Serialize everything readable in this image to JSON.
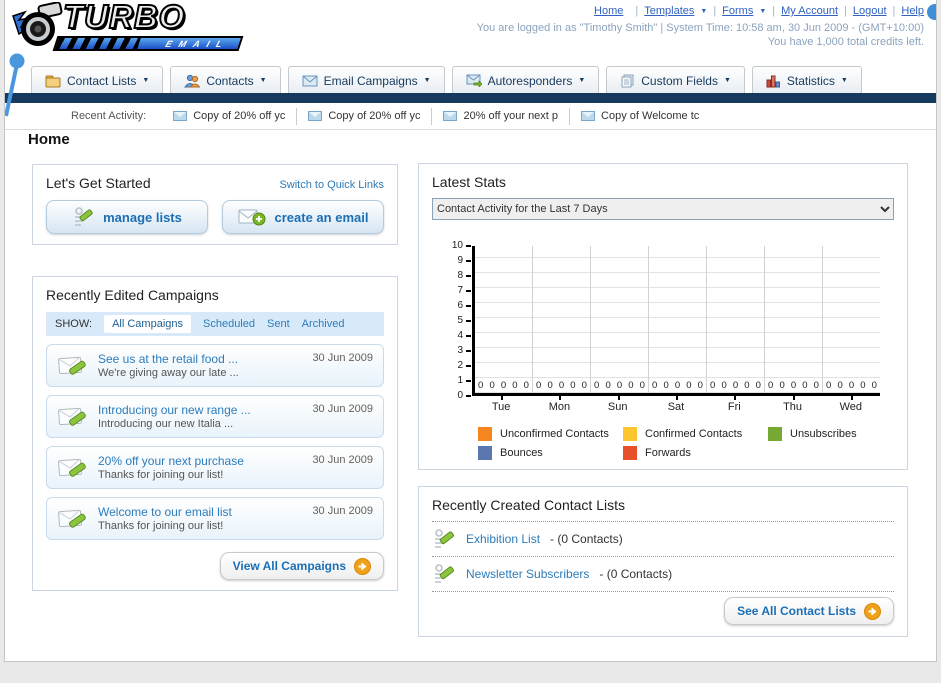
{
  "ui": {
    "caret": "▼",
    "separator": "|"
  },
  "header": {
    "logo": {
      "brand": "TURBO",
      "sub": "EMAIL"
    },
    "top_links": [
      {
        "label": "Home",
        "dropdown": false
      },
      {
        "label": "Templates",
        "dropdown": true
      },
      {
        "label": "Forms",
        "dropdown": true
      },
      {
        "label": "My Account",
        "dropdown": false
      },
      {
        "label": "Logout",
        "dropdown": false
      },
      {
        "label": "Help",
        "dropdown": false
      }
    ],
    "login_line1": "You are logged in as \"Timothy Smith\" | System Time: 10:58 am, 30 Jun 2009 - (GMT+10:00)",
    "login_line2": "You have 1,000 total credits left."
  },
  "nav": {
    "tabs": [
      {
        "label": "Contact Lists"
      },
      {
        "label": "Contacts"
      },
      {
        "label": "Email Campaigns"
      },
      {
        "label": "Autoresponders"
      },
      {
        "label": "Custom Fields"
      },
      {
        "label": "Statistics"
      }
    ]
  },
  "recent_activity": {
    "label": "Recent Activity:",
    "items": [
      "Copy of 20% off yc",
      "Copy of 20% off yc",
      "20% off your next p",
      "Copy of Welcome tc"
    ]
  },
  "page": {
    "title": "Home"
  },
  "get_started": {
    "title": "Let's Get Started",
    "switch_link": "Switch to Quick Links",
    "manage_lists": "manage lists",
    "create_email": "create an email"
  },
  "campaigns": {
    "title": "Recently Edited Campaigns",
    "show_label": "SHOW:",
    "filters": [
      "All Campaigns",
      "Scheduled",
      "Sent",
      "Archived"
    ],
    "active_filter": "All Campaigns",
    "items": [
      {
        "title": "See us at the retail food ...",
        "subtitle": "We're giving away our late ...",
        "date": "30 Jun 2009"
      },
      {
        "title": "Introducing our new range ...",
        "subtitle": "Introducing our new Italia ...",
        "date": "30 Jun 2009"
      },
      {
        "title": "20% off your next purchase",
        "subtitle": "Thanks for joining our list!",
        "date": "30 Jun 2009"
      },
      {
        "title": "Welcome to our email list",
        "subtitle": "Thanks for joining our list!",
        "date": "30 Jun 2009"
      }
    ],
    "view_all": "View All Campaigns"
  },
  "stats": {
    "title": "Latest Stats",
    "dropdown_value": "Contact Activity for the Last 7 Days"
  },
  "chart_data": {
    "type": "bar",
    "title": "Contact Activity for the Last 7 Days",
    "categories": [
      "Tue",
      "Mon",
      "Sun",
      "Sat",
      "Fri",
      "Thu",
      "Wed"
    ],
    "series": [
      {
        "name": "Unconfirmed Contacts",
        "color": "#f5861f",
        "values": [
          0,
          0,
          0,
          0,
          0,
          0,
          0
        ]
      },
      {
        "name": "Confirmed Contacts",
        "color": "#fdc62e",
        "values": [
          0,
          0,
          0,
          0,
          0,
          0,
          0
        ]
      },
      {
        "name": "Unsubscribes",
        "color": "#76a832",
        "values": [
          0,
          0,
          0,
          0,
          0,
          0,
          0
        ]
      },
      {
        "name": "Bounces",
        "color": "#5c76b0",
        "values": [
          0,
          0,
          0,
          0,
          0,
          0,
          0
        ]
      },
      {
        "name": "Forwards",
        "color": "#e8502c",
        "values": [
          0,
          0,
          0,
          0,
          0,
          0,
          0
        ]
      }
    ],
    "xlabel": "",
    "ylabel": "",
    "ylim": [
      0,
      10
    ],
    "ytick_step": 1,
    "grid": true,
    "legend_position": "bottom",
    "value_labels_shown": true
  },
  "contact_lists": {
    "title": "Recently Created Contact Lists",
    "items": [
      {
        "name": "Exhibition List",
        "detail": "- (0 Contacts)"
      },
      {
        "name": "Newsletter Subscribers",
        "detail": "- (0 Contacts)"
      }
    ],
    "see_all": "See All Contact Lists"
  }
}
